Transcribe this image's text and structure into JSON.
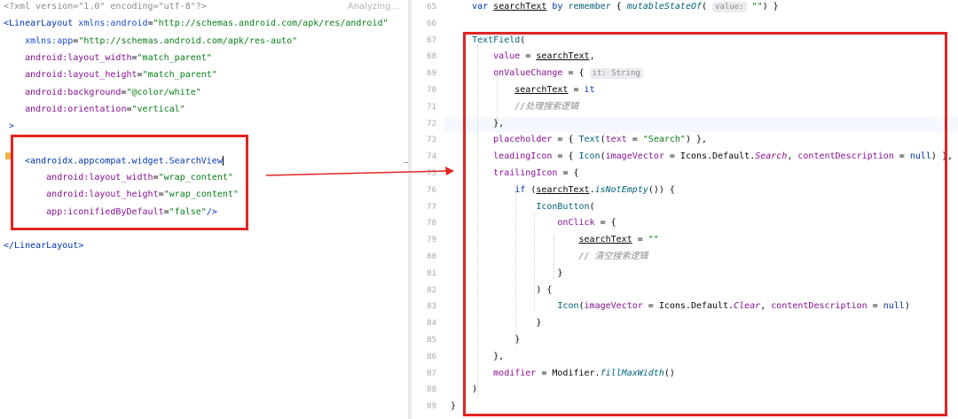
{
  "left_editor": {
    "status": "Analyzing...",
    "lines": [
      {
        "parts": [
          {
            "t": "<?xml version=\"1.0\" encoding=\"utf-8\"?>",
            "c": "xml-d"
          }
        ]
      },
      {
        "parts": [
          {
            "t": "<LinearLayout ",
            "c": "tag"
          },
          {
            "t": "xmlns:android",
            "c": "attr"
          },
          {
            "t": "=",
            "c": ""
          },
          {
            "t": "\"http://schemas.android.com/apk/res/android\"",
            "c": "str"
          }
        ]
      },
      {
        "parts": [
          {
            "t": "    xmlns:app",
            "c": "attr"
          },
          {
            "t": "=",
            "c": ""
          },
          {
            "t": "\"http://schemas.android.com/apk/res-auto\"",
            "c": "str"
          }
        ]
      },
      {
        "parts": [
          {
            "t": "    android:",
            "c": "attr-ns"
          },
          {
            "t": "layout_width",
            "c": "attr-ns"
          },
          {
            "t": "=",
            "c": ""
          },
          {
            "t": "\"match_parent\"",
            "c": "str"
          }
        ]
      },
      {
        "parts": [
          {
            "t": "    android:",
            "c": "attr-ns"
          },
          {
            "t": "layout_height",
            "c": "attr-ns"
          },
          {
            "t": "=",
            "c": ""
          },
          {
            "t": "\"match_parent\"",
            "c": "str"
          }
        ]
      },
      {
        "parts": [
          {
            "t": "    android:",
            "c": "attr-ns"
          },
          {
            "t": "background",
            "c": "attr-ns"
          },
          {
            "t": "=",
            "c": ""
          },
          {
            "t": "\"@color/white\"",
            "c": "str"
          }
        ]
      },
      {
        "parts": [
          {
            "t": "    android:",
            "c": "attr-ns"
          },
          {
            "t": "orientation",
            "c": "attr-ns"
          },
          {
            "t": "=",
            "c": ""
          },
          {
            "t": "\"vertical\"",
            "c": "str"
          }
        ]
      },
      {
        "parts": [
          {
            "t": " >",
            "c": "tag"
          }
        ]
      },
      {
        "parts": [
          {
            "t": "",
            "c": ""
          }
        ]
      },
      {
        "parts": [
          {
            "t": "    <androidx.appcompat.widget.SearchView",
            "c": "tag"
          }
        ],
        "caret": true
      },
      {
        "parts": [
          {
            "t": "        android:",
            "c": "attr-ns"
          },
          {
            "t": "layout_width",
            "c": "attr-ns"
          },
          {
            "t": "=",
            "c": ""
          },
          {
            "t": "\"wrap_content\"",
            "c": "str"
          }
        ]
      },
      {
        "parts": [
          {
            "t": "        android:",
            "c": "attr-ns"
          },
          {
            "t": "layout_height",
            "c": "attr-ns"
          },
          {
            "t": "=",
            "c": ""
          },
          {
            "t": "\"wrap_content\"",
            "c": "str"
          }
        ]
      },
      {
        "parts": [
          {
            "t": "        app:",
            "c": "attr-ns"
          },
          {
            "t": "iconifiedByDefault",
            "c": "attr-ns"
          },
          {
            "t": "=",
            "c": ""
          },
          {
            "t": "\"false\"",
            "c": "str"
          },
          {
            "t": "/>",
            "c": "tag"
          }
        ]
      },
      {
        "parts": [
          {
            "t": "",
            "c": ""
          }
        ]
      },
      {
        "parts": [
          {
            "t": "</LinearLayout>",
            "c": "tag"
          }
        ]
      }
    ]
  },
  "right_editor": {
    "line_numbers": [
      "65",
      "66",
      "67",
      "68",
      "69",
      "70",
      "71",
      "72",
      "73",
      "74",
      "75",
      "76",
      "77",
      "78",
      "79",
      "80",
      "81",
      "82",
      "83",
      "84",
      "85",
      "86",
      "87",
      "88",
      "89"
    ],
    "lines": [
      {
        "parts": [
          {
            "t": "    var ",
            "c": "kw"
          },
          {
            "t": "searchText",
            "c": "ul"
          },
          {
            "t": " by ",
            "c": "kw"
          },
          {
            "t": "remember",
            "c": "fn"
          },
          {
            "t": " { ",
            "c": ""
          },
          {
            "t": "mutableStateOf",
            "c": "fn it"
          },
          {
            "t": "( ",
            "c": ""
          },
          {
            "t": "value:",
            "c": "hint"
          },
          {
            "t": " \"\"",
            "c": "str"
          },
          {
            "t": ") }",
            "c": ""
          }
        ]
      },
      {
        "parts": [
          {
            "t": "",
            "c": ""
          }
        ]
      },
      {
        "parts": [
          {
            "t": "    TextField",
            "c": "fn"
          },
          {
            "t": "(",
            "c": ""
          }
        ]
      },
      {
        "parts": [
          {
            "t": "        value",
            "c": "prop"
          },
          {
            "t": " = ",
            "c": ""
          },
          {
            "t": "searchText",
            "c": "ul"
          },
          {
            "t": ",",
            "c": ""
          }
        ]
      },
      {
        "parts": [
          {
            "t": "        onValueChange",
            "c": "prop"
          },
          {
            "t": " = { ",
            "c": ""
          },
          {
            "t": "it: String",
            "c": "hint"
          }
        ]
      },
      {
        "parts": [
          {
            "t": "            ",
            "c": ""
          },
          {
            "t": "searchText",
            "c": "ul"
          },
          {
            "t": " = ",
            "c": ""
          },
          {
            "t": "it",
            "c": "kw"
          }
        ]
      },
      {
        "parts": [
          {
            "t": "            //处理搜索逻辑",
            "c": "cm"
          }
        ]
      },
      {
        "parts": [
          {
            "t": "        },",
            "c": ""
          }
        ]
      },
      {
        "parts": [
          {
            "t": "        placeholder",
            "c": "prop"
          },
          {
            "t": " = { ",
            "c": ""
          },
          {
            "t": "Text",
            "c": "fn"
          },
          {
            "t": "(",
            "c": ""
          },
          {
            "t": "text",
            "c": "prop"
          },
          {
            "t": " = ",
            "c": ""
          },
          {
            "t": "\"Search\"",
            "c": "str"
          },
          {
            "t": ") },",
            "c": ""
          }
        ]
      },
      {
        "parts": [
          {
            "t": "        leadingIcon",
            "c": "prop"
          },
          {
            "t": " = { ",
            "c": ""
          },
          {
            "t": "Icon",
            "c": "fn"
          },
          {
            "t": "(",
            "c": ""
          },
          {
            "t": "imageVector",
            "c": "prop"
          },
          {
            "t": " = Icons.Default.",
            "c": ""
          },
          {
            "t": "Search",
            "c": "prop it"
          },
          {
            "t": ", ",
            "c": ""
          },
          {
            "t": "contentDescription",
            "c": "prop"
          },
          {
            "t": " = ",
            "c": ""
          },
          {
            "t": "null",
            "c": "kw"
          },
          {
            "t": ") },",
            "c": ""
          }
        ]
      },
      {
        "parts": [
          {
            "t": "        trailingIcon",
            "c": "prop"
          },
          {
            "t": " = {",
            "c": ""
          }
        ]
      },
      {
        "parts": [
          {
            "t": "            if ",
            "c": "kw"
          },
          {
            "t": "(",
            "c": ""
          },
          {
            "t": "searchText",
            "c": "ul"
          },
          {
            "t": ".",
            "c": ""
          },
          {
            "t": "isNotEmpty",
            "c": "fn it"
          },
          {
            "t": "()) {",
            "c": ""
          }
        ]
      },
      {
        "parts": [
          {
            "t": "                IconButton",
            "c": "fn"
          },
          {
            "t": "(",
            "c": ""
          }
        ]
      },
      {
        "parts": [
          {
            "t": "                    onClick",
            "c": "prop"
          },
          {
            "t": " = {",
            "c": ""
          }
        ]
      },
      {
        "parts": [
          {
            "t": "                        ",
            "c": ""
          },
          {
            "t": "searchText",
            "c": "ul"
          },
          {
            "t": " = ",
            "c": ""
          },
          {
            "t": "\"\"",
            "c": "str"
          }
        ]
      },
      {
        "parts": [
          {
            "t": "                        // 清空搜索逻辑",
            "c": "cm"
          }
        ]
      },
      {
        "parts": [
          {
            "t": "                    }",
            "c": ""
          }
        ]
      },
      {
        "parts": [
          {
            "t": "                ) {",
            "c": ""
          }
        ]
      },
      {
        "parts": [
          {
            "t": "                    Icon",
            "c": "fn"
          },
          {
            "t": "(",
            "c": ""
          },
          {
            "t": "imageVector",
            "c": "prop"
          },
          {
            "t": " = Icons.Default.",
            "c": ""
          },
          {
            "t": "Clear",
            "c": "prop it"
          },
          {
            "t": ", ",
            "c": ""
          },
          {
            "t": "contentDescription",
            "c": "prop"
          },
          {
            "t": " = ",
            "c": ""
          },
          {
            "t": "null",
            "c": "kw"
          },
          {
            "t": ")",
            "c": ""
          }
        ]
      },
      {
        "parts": [
          {
            "t": "                }",
            "c": ""
          }
        ]
      },
      {
        "parts": [
          {
            "t": "            }",
            "c": ""
          }
        ]
      },
      {
        "parts": [
          {
            "t": "        },",
            "c": ""
          }
        ]
      },
      {
        "parts": [
          {
            "t": "        modifier",
            "c": "prop"
          },
          {
            "t": " = Modifier.",
            "c": ""
          },
          {
            "t": "fillMaxWidth",
            "c": "fn it"
          },
          {
            "t": "()",
            "c": ""
          }
        ]
      },
      {
        "parts": [
          {
            "t": "    )",
            "c": ""
          }
        ]
      },
      {
        "parts": [
          {
            "t": "}",
            "c": ""
          }
        ]
      }
    ]
  },
  "annotation": {
    "box_color": "#e02424",
    "arrow_icon": "arrow-right-icon"
  }
}
